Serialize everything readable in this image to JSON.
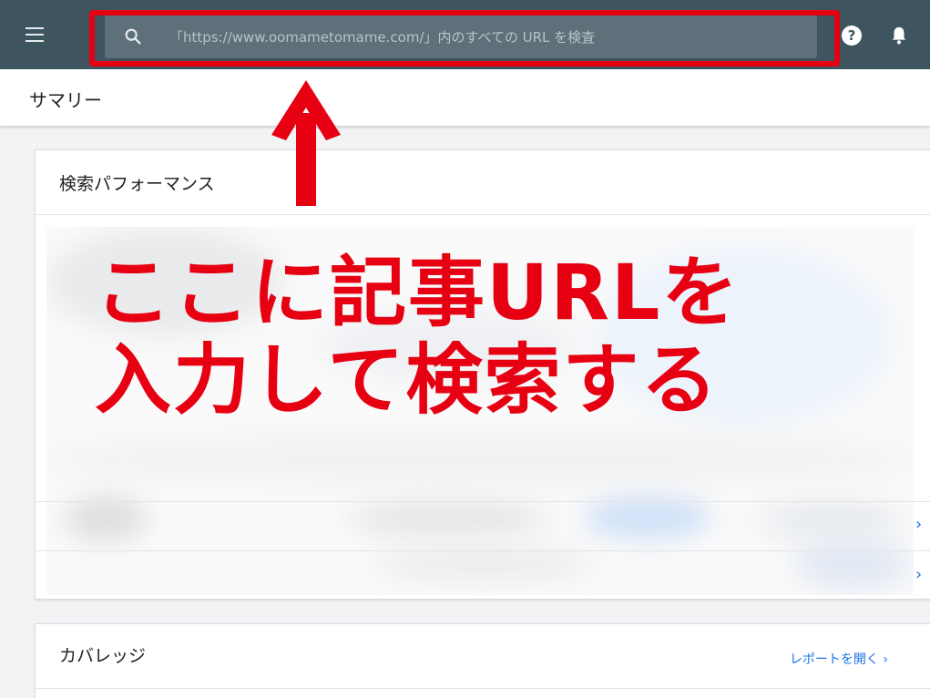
{
  "topbar": {
    "search_placeholder": "「https://www.oomametomame.com/」内のすべての URL を検査",
    "help_glyph": "?"
  },
  "summary": {
    "title": "サマリー"
  },
  "performance_card": {
    "title": "検索パフォーマンス",
    "chevron": "›"
  },
  "coverage_card": {
    "title": "カバレッジ",
    "report_link": "レポートを開く ›"
  },
  "annotation": {
    "line1": "ここに記事URLを",
    "line2": "入力して検索する",
    "color": "#e60012"
  },
  "colors": {
    "topbar": "#3e5560",
    "search_box": "#5e7079",
    "link": "#1a73e8",
    "highlight": "#e60012"
  }
}
